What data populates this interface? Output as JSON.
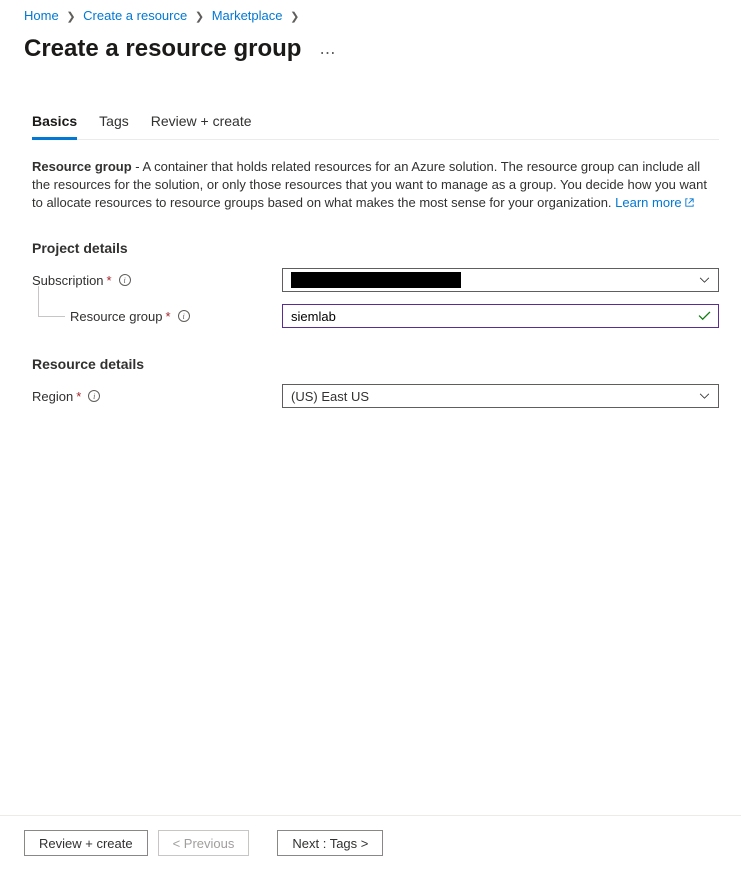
{
  "breadcrumb": {
    "items": [
      "Home",
      "Create a resource",
      "Marketplace"
    ]
  },
  "page": {
    "title": "Create a resource group"
  },
  "tabs": {
    "items": [
      {
        "label": "Basics",
        "active": true
      },
      {
        "label": "Tags",
        "active": false
      },
      {
        "label": "Review + create",
        "active": false
      }
    ]
  },
  "description": {
    "bold": "Resource group",
    "text": " - A container that holds related resources for an Azure solution. The resource group can include all the resources for the solution, or only those resources that you want to manage as a group. You decide how you want to allocate resources to resource groups based on what makes the most sense for your organization. ",
    "learn_more": "Learn more"
  },
  "sections": {
    "project_details": {
      "heading": "Project details",
      "subscription": {
        "label": "Subscription",
        "value": ""
      },
      "resource_group": {
        "label": "Resource group",
        "value": "siemlab"
      }
    },
    "resource_details": {
      "heading": "Resource details",
      "region": {
        "label": "Region",
        "value": "(US) East US"
      }
    }
  },
  "footer": {
    "review": "Review + create",
    "previous": "< Previous",
    "next": "Next : Tags >"
  }
}
